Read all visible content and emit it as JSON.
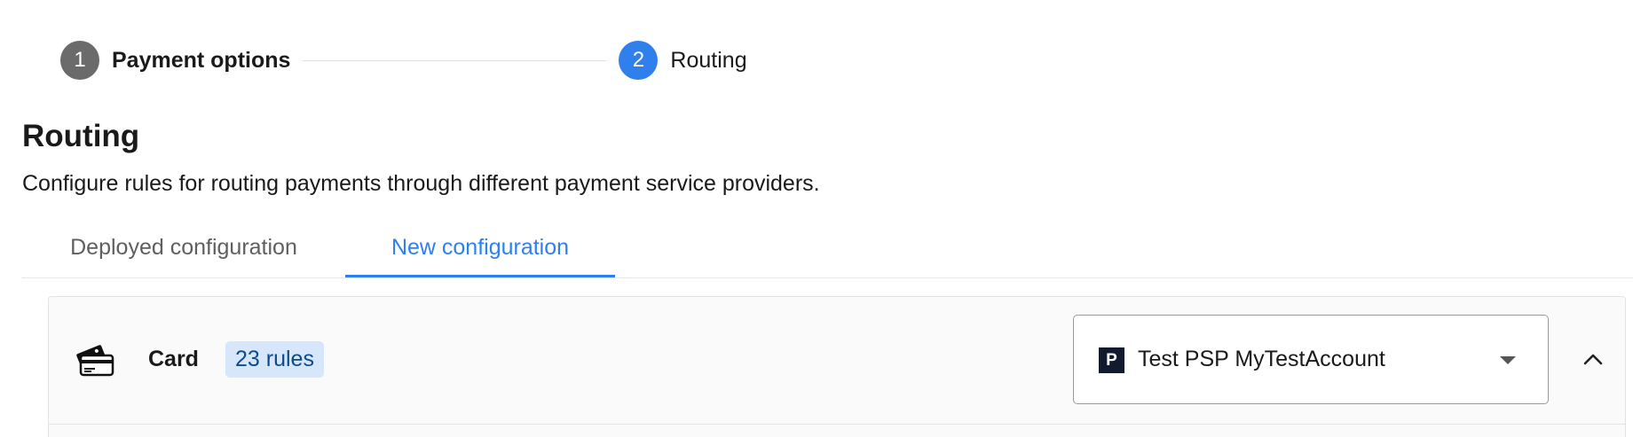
{
  "stepper": {
    "steps": [
      {
        "number": "1",
        "label": "Payment options",
        "state": "completed"
      },
      {
        "number": "2",
        "label": "Routing",
        "state": "active"
      }
    ]
  },
  "page": {
    "title": "Routing",
    "subtitle": "Configure rules for routing payments through different payment service providers."
  },
  "tabs": [
    {
      "label": "Deployed configuration",
      "selected": false
    },
    {
      "label": "New configuration",
      "selected": true
    }
  ],
  "payment_method": {
    "icon": "credit-card-icon",
    "label": "Card",
    "rules_badge": "23 rules",
    "psp_select": {
      "logo_letter": "P",
      "value": "Test PSP MyTestAccount"
    },
    "collapse_icon": "chevron-up-icon"
  },
  "colors": {
    "accent": "#2f80ed",
    "step_done": "#6b6b6b",
    "badge_bg": "#d6e7fb",
    "badge_text": "#0d4a8c"
  }
}
